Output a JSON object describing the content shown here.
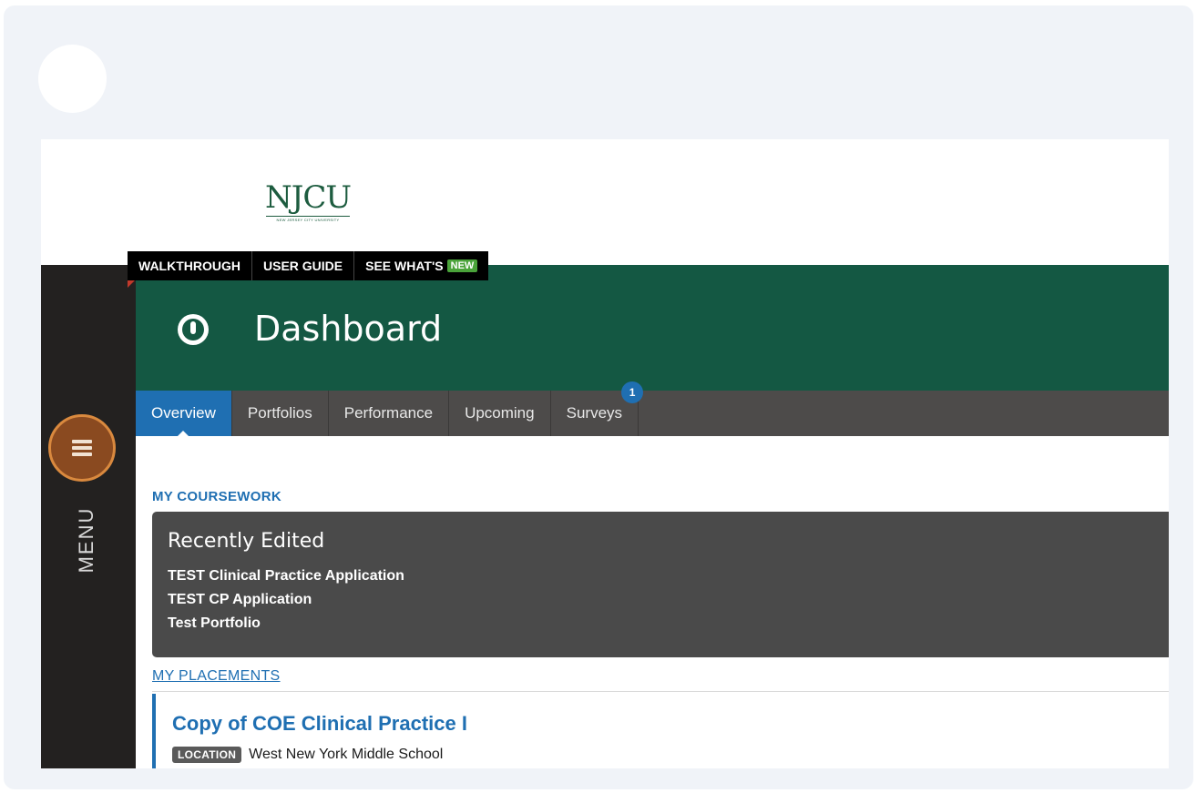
{
  "logo": {
    "text": "NJCU",
    "tagline": "NEW JERSEY CITY UNIVERSITY"
  },
  "top_links": {
    "walkthrough": "WALKTHROUGH",
    "user_guide": "USER GUIDE",
    "see_whats": "SEE WHAT'S",
    "new_badge": "NEW"
  },
  "sidebar": {
    "menu_label": "MENU",
    "menu_icon": "hamburger-icon"
  },
  "header": {
    "title": "Dashboard",
    "icon": "dashboard-gauge-icon"
  },
  "tabs": [
    {
      "label": "Overview",
      "active": true
    },
    {
      "label": "Portfolios"
    },
    {
      "label": "Performance"
    },
    {
      "label": "Upcoming"
    },
    {
      "label": "Surveys",
      "badge": "1"
    }
  ],
  "coursework": {
    "heading": "MY COURSEWORK",
    "recent_title": "Recently Edited",
    "items": [
      "TEST Clinical Practice Application",
      "TEST CP Application",
      "Test Portfolio"
    ]
  },
  "placements": {
    "link": "MY PLACEMENTS",
    "card_title": "Copy of COE Clinical Practice I",
    "location_label": "LOCATION",
    "location_value": "West New York Middle School"
  },
  "colors": {
    "brand_green": "#145843",
    "accent_blue": "#1f6fb2",
    "menu_orange": "#d9893e"
  }
}
